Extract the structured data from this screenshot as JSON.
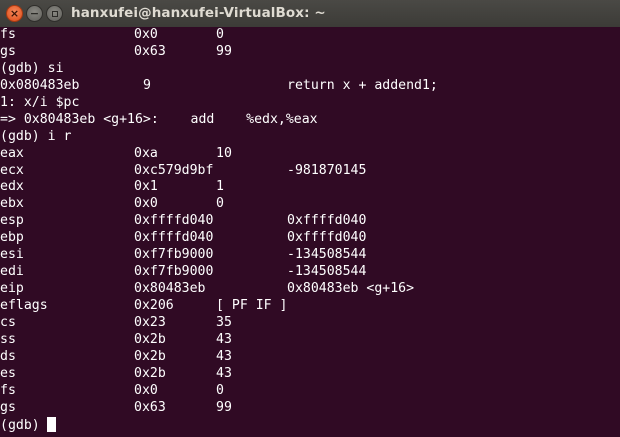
{
  "window": {
    "title": "hanxufei@hanxufei-VirtualBox: ~",
    "close_glyph": "×",
    "min_glyph": "−"
  },
  "terminal": {
    "row1": {
      "name": "fs",
      "hex": "0x0",
      "val": "0"
    },
    "row2": {
      "name": "gs",
      "hex": "0x63",
      "val": "99"
    },
    "row3": {
      "text": "(gdb) si"
    },
    "row4": {
      "addr": "0x080483eb",
      "lineno": "9",
      "src": "return x + addend1;"
    },
    "row5": {
      "text": "1: x/i $pc"
    },
    "row6": {
      "text": "=> 0x80483eb <g+16>:    add    %edx,%eax"
    },
    "row7": {
      "text": "(gdb) i r"
    },
    "regs": [
      {
        "name": "eax",
        "hex": "0xa",
        "val": "10"
      },
      {
        "name": "ecx",
        "hex": "0xc579d9bf",
        "val": "-981870145"
      },
      {
        "name": "edx",
        "hex": "0x1",
        "val": "1"
      },
      {
        "name": "ebx",
        "hex": "0x0",
        "val": "0"
      },
      {
        "name": "esp",
        "hex": "0xffffd040",
        "val": "0xffffd040"
      },
      {
        "name": "ebp",
        "hex": "0xffffd040",
        "val": "0xffffd040"
      },
      {
        "name": "esi",
        "hex": "0xf7fb9000",
        "val": "-134508544"
      },
      {
        "name": "edi",
        "hex": "0xf7fb9000",
        "val": "-134508544"
      },
      {
        "name": "eip",
        "hex": "0x80483eb",
        "val": "0x80483eb <g+16>"
      },
      {
        "name": "eflags",
        "hex": "0x206",
        "val": "[ PF IF ]"
      },
      {
        "name": "cs",
        "hex": "0x23",
        "val": "35"
      },
      {
        "name": "ss",
        "hex": "0x2b",
        "val": "43"
      },
      {
        "name": "ds",
        "hex": "0x2b",
        "val": "43"
      },
      {
        "name": "es",
        "hex": "0x2b",
        "val": "43"
      },
      {
        "name": "fs",
        "hex": "0x0",
        "val": "0"
      },
      {
        "name": "gs",
        "hex": "0x63",
        "val": "99"
      }
    ],
    "prompt": "(gdb)"
  },
  "colors": {
    "background": "#300a24",
    "text": "#ffffff",
    "title_text": "#dfdbd2",
    "close_button": "#df4a16"
  },
  "icons": {
    "close": "close-icon",
    "minimize": "minimize-icon",
    "maximize": "maximize-icon"
  }
}
